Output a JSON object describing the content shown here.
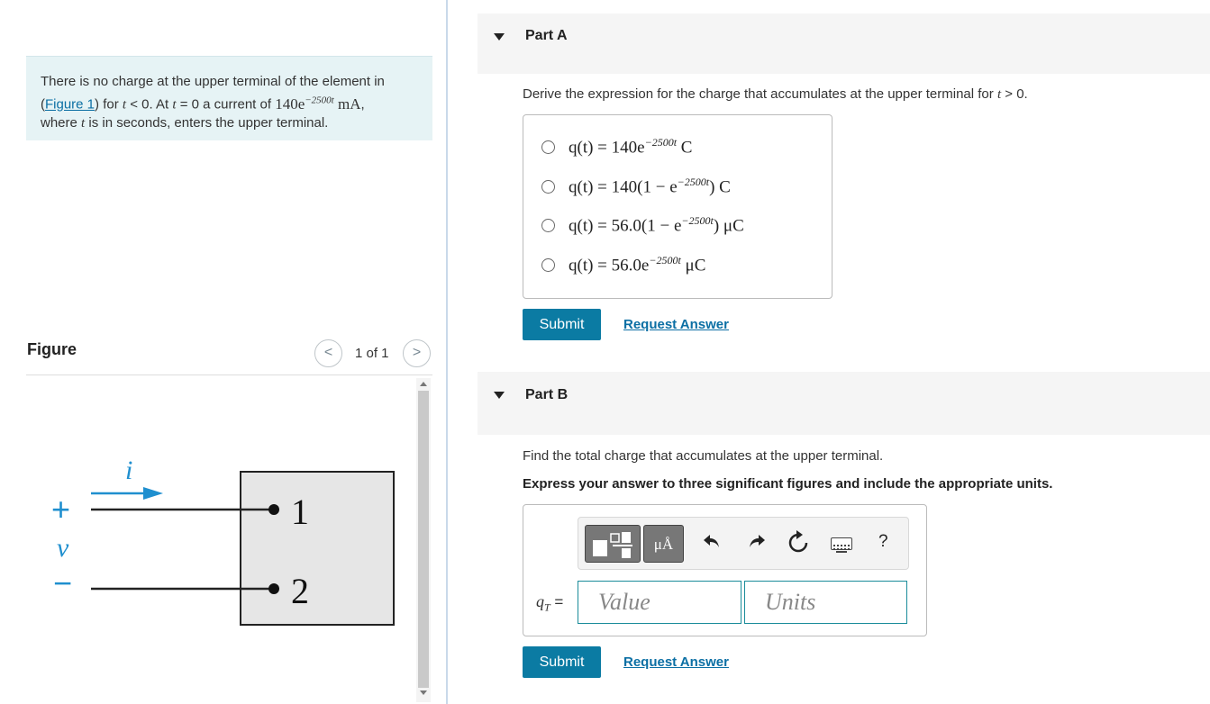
{
  "problem": {
    "text_1": "There is no charge at the upper terminal of the element in",
    "figure_link": "Figure 1",
    "text_2": "for",
    "cond_var": "t",
    "cond_1": " < 0. At ",
    "cond_var2": "t",
    "cond_2": " = 0 a current of ",
    "current_base": "140e",
    "current_exp": "−2500t",
    "current_unit": " mA",
    "text_3": "where",
    "text_4": "is in seconds, enters the upper terminal."
  },
  "figure": {
    "label": "Figure",
    "pager": "1 of 1",
    "prev_icon": "chevron-left-icon",
    "next_icon": "chevron-right-icon",
    "labels": {
      "current": "i",
      "plus": "+",
      "voltage": "v",
      "minus": "−",
      "terminal_1": "1",
      "terminal_2": "2"
    }
  },
  "part_a": {
    "title": "Part A",
    "prompt": "Derive the expression for the charge that accumulates at the upper terminal for",
    "prompt_var": "t",
    "prompt_tail": " > 0.",
    "choices": [
      {
        "pre": "q(t) = 140e",
        "exp": "−2500t",
        "post": " C"
      },
      {
        "pre": "q(t) = 140(1 − e",
        "exp": "−2500t",
        "post": ") C"
      },
      {
        "pre": "q(t) = 56.0(1 − e",
        "exp": "−2500t",
        "post": ") μC"
      },
      {
        "pre": "q(t) = 56.0e",
        "exp": "−2500t",
        "post": " μC"
      }
    ],
    "submit": "Submit",
    "request": "Request Answer"
  },
  "part_b": {
    "title": "Part B",
    "prompt": "Find the total charge that accumulates at the upper terminal.",
    "instruction": "Express your answer to three significant figures and include the appropriate units.",
    "toolbar": {
      "units_label": "μÅ",
      "icons": [
        "templates-icon",
        "units-icon",
        "undo-icon",
        "redo-icon",
        "reset-icon",
        "keyboard-icon",
        "help-icon"
      ],
      "help": "?"
    },
    "answer_label_var": "q",
    "answer_label_sub": "T",
    "answer_label_eq": " =",
    "value_placeholder": "Value",
    "units_placeholder": "Units",
    "submit": "Submit",
    "request": "Request Answer"
  }
}
